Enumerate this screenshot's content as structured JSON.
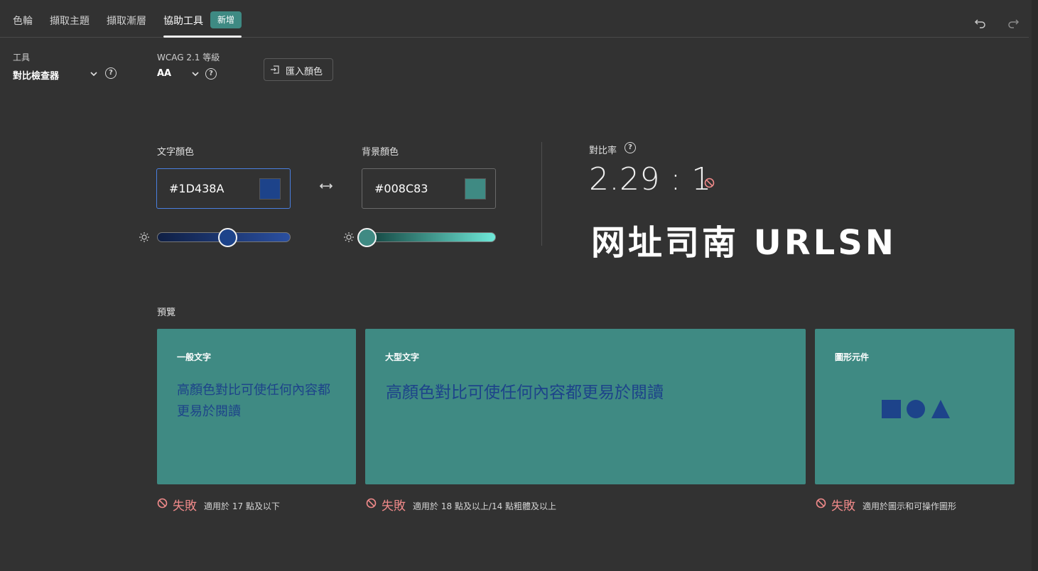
{
  "nav": {
    "tabs": [
      {
        "label": "色輪"
      },
      {
        "label": "擷取主題"
      },
      {
        "label": "擷取漸層"
      },
      {
        "label": "協助工具"
      }
    ],
    "new_badge": "新增",
    "undo_icon": "undo-icon",
    "redo_icon": "redo-icon"
  },
  "toolbar": {
    "tool_label": "工具",
    "tool_value": "對比檢查器",
    "wcag_label": "WCAG 2.1 等級",
    "wcag_value": "AA",
    "import_label": "匯入顏色"
  },
  "text_color": {
    "label": "文字顏色",
    "hex": "#1D438A",
    "swatch": "#1D438A"
  },
  "bg_color": {
    "label": "背景顏色",
    "hex": "#008C83",
    "swatch": "#3f8a83"
  },
  "contrast": {
    "label": "對比率",
    "value": "2.29 : 1"
  },
  "watermark": "网址司南 URLSN",
  "preview": {
    "label": "預覽",
    "cards": [
      {
        "title": "一般文字",
        "text": "高顏色對比可使任何內容都更易於閱讀"
      },
      {
        "title": "大型文字",
        "text": "高顏色對比可使任何內容都更易於閱讀"
      },
      {
        "title": "圖形元件"
      }
    ],
    "results": [
      {
        "status": "失敗",
        "note": "適用於 17 點及以下"
      },
      {
        "status": "失敗",
        "note": "適用於 18 點及以上/14 點粗體及以上"
      },
      {
        "status": "失敗",
        "note": "適用於圖示和可操作圖形"
      }
    ]
  },
  "colors": {
    "fail": "#f08a8a",
    "accent": "#3e8a83",
    "text_sample": "#1d438a"
  }
}
